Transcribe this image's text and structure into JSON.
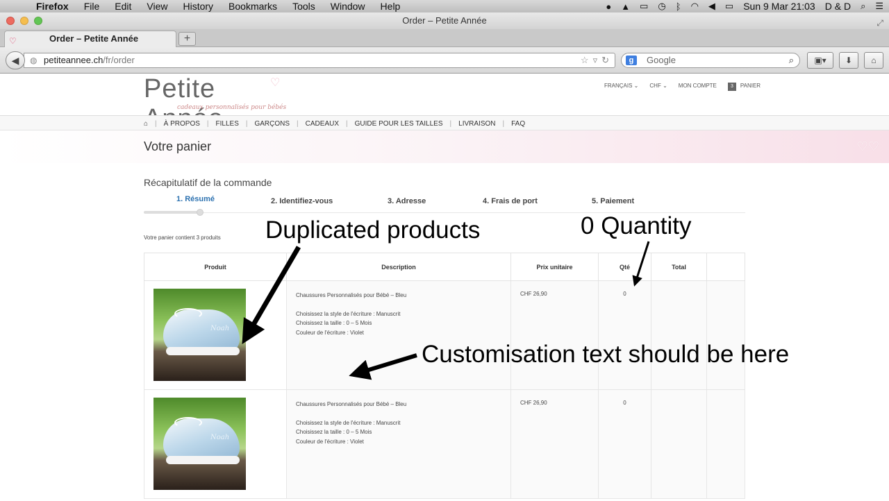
{
  "menubar": {
    "app_name": "Firefox",
    "menus": [
      "File",
      "Edit",
      "View",
      "History",
      "Bookmarks",
      "Tools",
      "Window",
      "Help"
    ],
    "clock": "Sun 9 Mar  21:03",
    "user": "D & D"
  },
  "window": {
    "title": "Order – Petite Année"
  },
  "tab": {
    "label": "Order – Petite Année"
  },
  "url": {
    "host": "petiteannee.ch",
    "path": "/fr/order"
  },
  "search": {
    "placeholder": "Google"
  },
  "site": {
    "logo_text": "Petite Année",
    "logo_subtitle": "cadeaux personnalisés pour bébés",
    "top_links": {
      "language": "FRANÇAIS",
      "currency": "CHF",
      "account": "MON COMPTE",
      "cart_count": "3",
      "cart": "PANIER"
    },
    "nav": [
      "À PROPOS",
      "FILLES",
      "GARÇONS",
      "CADEAUX",
      "GUIDE POUR LES TAILLES",
      "LIVRAISON",
      "FAQ"
    ],
    "page_title": "Votre panier",
    "recap_title": "Récapitulatif de la commande",
    "steps": [
      "1. Résumé",
      "2. Identifiez-vous",
      "3. Adresse",
      "4. Frais de port",
      "5. Paiement"
    ],
    "cart_info": "Votre panier contient 3 produits",
    "table_headers": {
      "product": "Produit",
      "description": "Description",
      "unit_price": "Prix unitaire",
      "qty": "Qté",
      "total": "Total"
    },
    "rows": [
      {
        "image_caption": "Noah",
        "title": "Chaussures Personnalisés pour Bébé – Bleu",
        "opt_style": "Choisissez la style de l'écriture : Manuscrit",
        "opt_size": "Choisissez la taille : 0 – 5 Mois",
        "opt_color": "Couleur de l'écriture : Violet",
        "price": "CHF 26,90",
        "qty": "0"
      },
      {
        "image_caption": "Noah",
        "title": "Chaussures Personnalisés pour Bébé – Bleu",
        "opt_style": "Choisissez la style de l'écriture : Manuscrit",
        "opt_size": "Choisissez la taille : 0 – 5 Mois",
        "opt_color": "Couleur de l'écriture : Violet",
        "price": "CHF 26,90",
        "qty": "0"
      }
    ]
  },
  "annotations": {
    "duplicated": "Duplicated products",
    "zero_qty": "0 Quantity",
    "customisation": "Customisation text should be here"
  }
}
